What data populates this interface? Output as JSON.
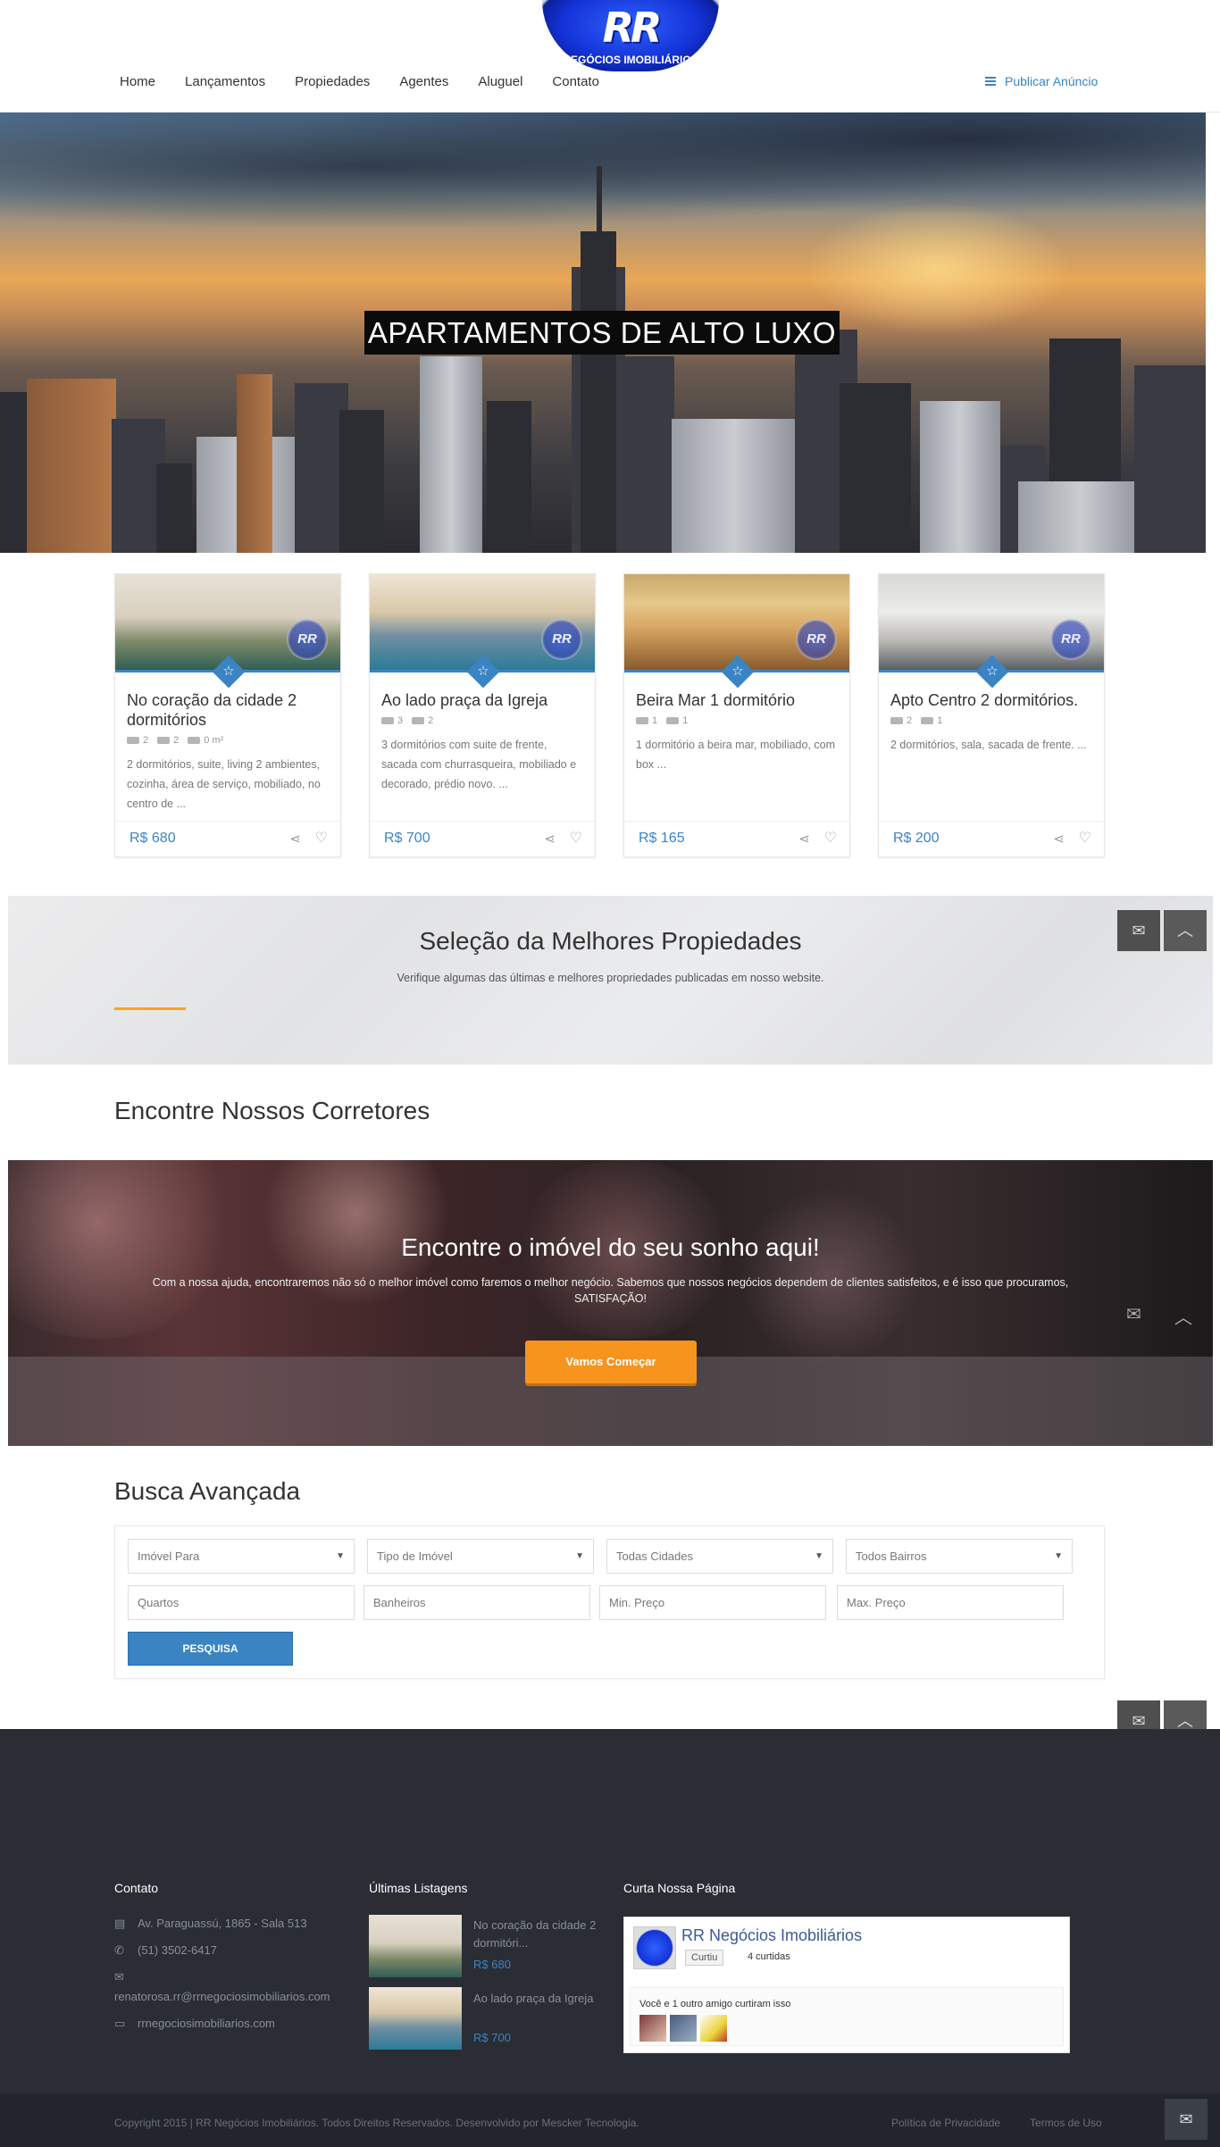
{
  "brand": {
    "mark": "RR",
    "name": "NEGÓCIOS IMOBILIÁRIOS"
  },
  "nav": {
    "items": [
      "Home",
      "Lançamentos",
      "Propiedades",
      "Agentes",
      "Aluguel",
      "Contato"
    ],
    "publish": "Publicar Anúncio"
  },
  "hero": {
    "title": "APARTAMENTOS DE ALTO LUXO"
  },
  "listings": [
    {
      "title": "No coração da cidade 2 dormitórios",
      "beds": "2",
      "baths": "2",
      "area": "0 m²",
      "desc": "2 dormitórios, suite, living 2 ambientes, cozinha, área de serviço, mobiliado, no centro de ...",
      "price": "R$ 680"
    },
    {
      "title": "Ao lado praça da Igreja",
      "beds": "3",
      "baths": "2",
      "desc": "3 dormitórios com suite de frente, sacada com churrasqueira, mobiliado e decorado, prédio novo. ...",
      "price": "R$ 700"
    },
    {
      "title": "Beira Mar 1 dormitório",
      "beds": "1",
      "baths": "1",
      "desc": "1 dormitório a beira mar, mobiliado, com box ...",
      "price": "R$ 165"
    },
    {
      "title": "Apto Centro 2 dormitórios.",
      "beds": "2",
      "baths": "1",
      "desc": "2 dormitórios, sala, sacada de frente. ...",
      "price": "R$ 200"
    }
  ],
  "selection": {
    "title": "Seleção da Melhores Propiedades",
    "subtitle": "Verifique algumas das últimas e melhores propriedades publicadas em nosso website."
  },
  "agents": {
    "title": "Encontre Nossos Corretores"
  },
  "cta": {
    "title": "Encontre o imóvel do seu sonho aqui!",
    "text": "Com a nossa ajuda, encontraremos não só o melhor imóvel como faremos o melhor negócio. Sabemos que nossos negócios dependem de clientes satisfeitos, e é isso que procuramos, SATISFAÇÃO!",
    "button": "Vamos Começar"
  },
  "search": {
    "title": "Busca Avançada",
    "selects": [
      "Imóvel Para",
      "Tipo de Imóvel",
      "Todas Cidades",
      "Todos Bairros"
    ],
    "inputs": [
      "Quartos",
      "Banheiros",
      "Min. Preço",
      "Max. Preço"
    ],
    "button": "PESQUISA"
  },
  "footer": {
    "contact_title": "Contato",
    "address": "Av. Paraguassú, 1865 - Sala 513",
    "phone": "(51) 3502-6417",
    "email": "renatorosa.rr@rrnegociosimobiliarios.com",
    "site": "rrnegociosimobiliarios.com",
    "latest_title": "Últimas Listagens",
    "latest": [
      {
        "title": "No coração da cidade 2 dormitóri...",
        "price": "R$ 680"
      },
      {
        "title": "Ao lado praça da Igreja",
        "price": "R$ 700"
      }
    ],
    "fb_title": "Curta Nossa Página",
    "fb_name": "RR Negócios Imobiliários",
    "fb_like": "Curtiu",
    "fb_count": "4 curtidas",
    "fb_friends": "Você e 1 outro amigo curtiram isso",
    "copyright": "Copyright 2015 | RR Negócios Imobiliários. Todos Direitos Reservados. Desenvolvido por Mescker Tecnologia.",
    "privacy": "Política de Privacidade",
    "terms": "Termos de Uso"
  },
  "icons": {
    "mail": "mail-icon",
    "up": "arrow-up-icon",
    "star": "star-icon",
    "share": "share-icon",
    "heart": "heart-icon"
  },
  "colors": {
    "accent": "#3a84c4",
    "orange": "#f7941d",
    "footer": "#2a2d34"
  }
}
